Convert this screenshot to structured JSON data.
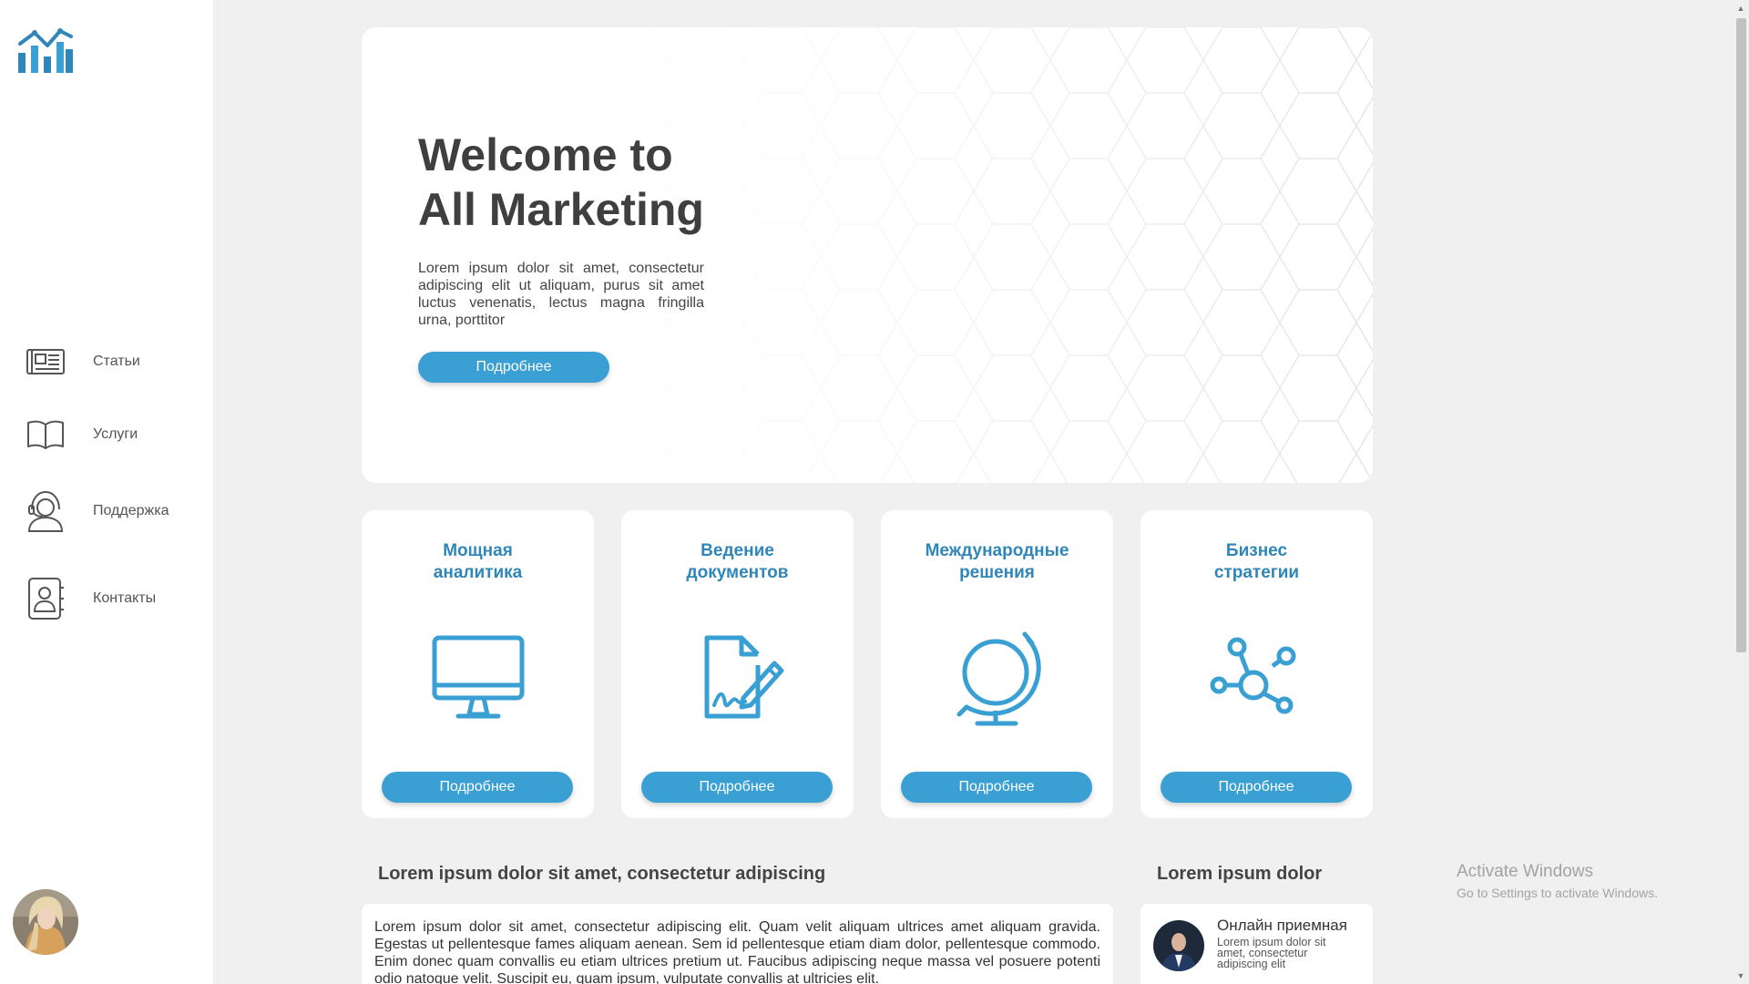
{
  "sidebar": {
    "logo_icon": "analytics-chart-icon",
    "items": [
      {
        "label": "Статьи",
        "icon": "newspaper-icon"
      },
      {
        "label": "Услуги",
        "icon": "open-book-icon"
      },
      {
        "label": "Поддержка",
        "icon": "headset-support-icon"
      },
      {
        "label": "Контакты",
        "icon": "contact-book-icon"
      }
    ],
    "avatar_icon": "user-avatar"
  },
  "hero": {
    "title_line1": "Welcome to",
    "title_line2": "All Marketing",
    "text": "Lorem ipsum dolor sit amet, consectetur adipiscing elit ut aliquam, purus sit amet luctus venenatis, lectus magna fringilla urna, porttitor",
    "button": "Подробнее"
  },
  "cards": [
    {
      "title_line1": "Мощная",
      "title_line2": "аналитика",
      "icon": "monitor-icon",
      "button": "Подробнее"
    },
    {
      "title_line1": "Ведение",
      "title_line2": "документов",
      "icon": "document-sign-icon",
      "button": "Подробнее"
    },
    {
      "title_line1": "Международные",
      "title_line2": "решения",
      "icon": "globe-icon",
      "button": "Подробнее"
    },
    {
      "title_line1": "Бизнес",
      "title_line2": "стратегии",
      "icon": "network-nodes-icon",
      "button": "Подробнее"
    }
  ],
  "article_section": {
    "title": "Lorem ipsum dolor sit amet, consectetur adipiscing",
    "text": "Lorem ipsum dolor sit amet, consectetur adipiscing elit. Quam velit aliquam ultrices amet aliquam gravida. Egestas ut pellentesque fames aliquam aenean. Sem id pellentesque etiam diam dolor, pellentesque commodo. Enim donec quam convallis eu etiam ultrices pretium ut. Faucibus adipiscing neque massa vel posuere potenti odio natoque velit. Suscipit eu, quam ipsum, vulputate convallis at ultricies elit."
  },
  "reception_section": {
    "title": "Lorem ipsum dolor",
    "card_title": "Онлайн приемная",
    "card_text": "Lorem ipsum dolor sit amet, consectetur adipiscing elit"
  },
  "watermark": {
    "title": "Activate Windows",
    "subtitle": "Go to Settings to activate Windows."
  },
  "colors": {
    "accent": "#3aa0d4",
    "card_title": "#2f86b8",
    "background": "#f0f0f0"
  }
}
